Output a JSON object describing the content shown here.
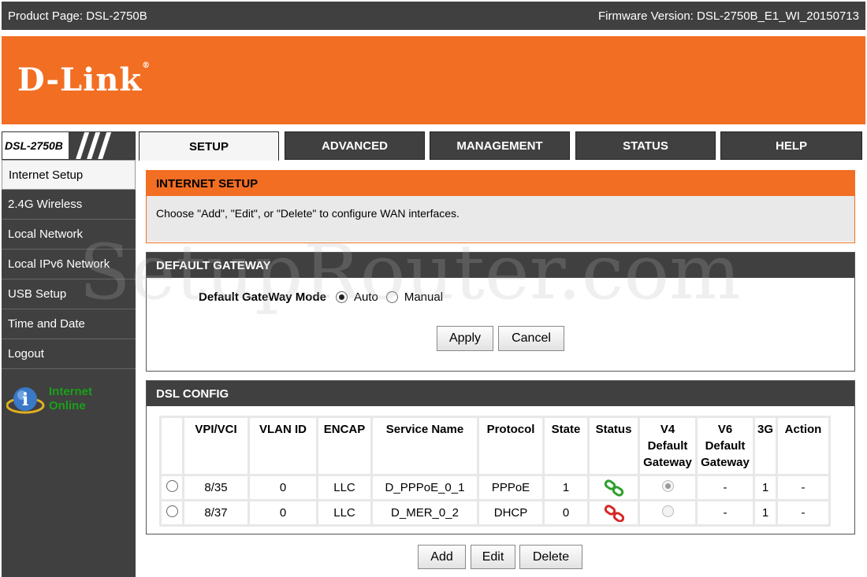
{
  "topbar": {
    "product_page": "Product Page: DSL-2750B",
    "firmware_version": "Firmware Version: DSL-2750B_E1_WI_20150713"
  },
  "banner": {
    "logo_text": "D-Link",
    "logo_mark": "®"
  },
  "model_badge": "DSL-2750B",
  "tabs": [
    {
      "label": "SETUP",
      "active": true
    },
    {
      "label": "ADVANCED",
      "active": false
    },
    {
      "label": "MANAGEMENT",
      "active": false
    },
    {
      "label": "STATUS",
      "active": false
    },
    {
      "label": "HELP",
      "active": false
    }
  ],
  "sidebar": {
    "items": [
      {
        "label": "Internet Setup",
        "active": true
      },
      {
        "label": "2.4G Wireless"
      },
      {
        "label": "Local Network"
      },
      {
        "label": "Local IPv6 Network"
      },
      {
        "label": "USB Setup"
      },
      {
        "label": "Time and Date"
      },
      {
        "label": "Logout"
      }
    ],
    "status_line1": "Internet",
    "status_line2": "Online",
    "status_color": "#1aa01a",
    "status_icon": "info-globe-icon"
  },
  "intro": {
    "title": "INTERNET SETUP",
    "text": "Choose \"Add\", \"Edit\", or \"Delete\" to configure WAN interfaces."
  },
  "gateway": {
    "title": "DEFAULT GATEWAY",
    "mode_label": "Default GateWay Mode",
    "options": [
      "Auto",
      "Manual"
    ],
    "selected": "Auto",
    "apply_label": "Apply",
    "cancel_label": "Cancel"
  },
  "dsl": {
    "title": "DSL CONFIG",
    "headers": {
      "vpi_vci": "VPI/VCI",
      "vlan_id": "VLAN ID",
      "encap": "ENCAP",
      "service_name": "Service Name",
      "protocol": "Protocol",
      "state": "State",
      "status": "Status",
      "v4_line1": "V4",
      "v4_line2": "Default",
      "v4_line3": "Gateway",
      "v6_line1": "V6",
      "v6_line2": "Default",
      "v6_line3": "Gateway",
      "g3": "3G",
      "action": "Action"
    },
    "rows": [
      {
        "vpi_vci": "8/35",
        "vlan_id": "0",
        "encap": "LLC",
        "service_name": "D_PPPoE_0_1",
        "protocol": "PPPoE",
        "state": "1",
        "status": "connected",
        "v4_selected": true,
        "v6": "-",
        "g3": "1",
        "action": "-"
      },
      {
        "vpi_vci": "8/37",
        "vlan_id": "0",
        "encap": "LLC",
        "service_name": "D_MER_0_2",
        "protocol": "DHCP",
        "state": "0",
        "status": "disconnected",
        "v4_selected": false,
        "v6": "-",
        "g3": "1",
        "action": "-"
      }
    ],
    "add_label": "Add",
    "edit_label": "Edit",
    "delete_label": "Delete"
  },
  "colors": {
    "brand_orange": "#f26e23",
    "dark_gray": "#404040",
    "link_up": "#2ca02c",
    "link_down": "#d62728"
  },
  "watermark": "SetupRouter.com"
}
